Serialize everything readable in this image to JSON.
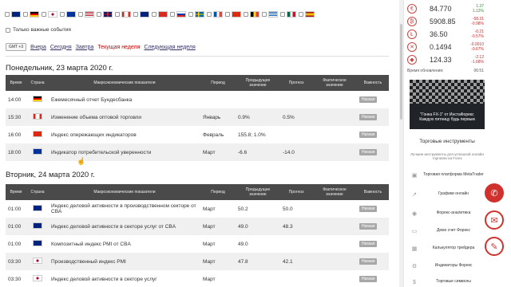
{
  "filters": {
    "important_only_label": "Только важные события"
  },
  "periods": {
    "tz": "GMT +3",
    "yesterday": "Вчера",
    "today": "Сегодня",
    "tomorrow": "Завтра",
    "this_week": "Текущая неделя",
    "next_week": "Следующая неделя"
  },
  "columns": {
    "time": "Время",
    "country": "Страна",
    "indicator": "Макроэкономические показатели",
    "period": "Период",
    "previous": "Предыдущее значение",
    "forecast": "Прогноз",
    "actual": "Фактическое значение",
    "importance": "Важность"
  },
  "day1": {
    "title": "Понедельник, 23 марта 2020 г.",
    "rows": [
      {
        "time": "14:00",
        "flag": "de",
        "name": "Ежемесячный отчет Бундесбанка",
        "period": "",
        "prev": "",
        "forecast": "",
        "actual": "",
        "imp": "Низкая"
      },
      {
        "time": "15:30",
        "flag": "ca",
        "name": "Изменение объема оптовой торговли",
        "period": "Январь",
        "prev": "0.9%",
        "forecast": "0.5%",
        "actual": "",
        "imp": "Низкая"
      },
      {
        "time": "16:00",
        "flag": "cn",
        "name": "Индекс опережающих индикаторов",
        "period": "Февраль",
        "prev": "155.8; 1.0%",
        "forecast": "",
        "actual": "",
        "imp": "Низкая"
      },
      {
        "time": "18:00",
        "flag": "eu",
        "name": "Индикатор потребительской уверенности",
        "period": "Март",
        "prev": "-6.6",
        "forecast": "-14.0",
        "actual": "",
        "imp": "Низкая"
      }
    ]
  },
  "day2": {
    "title": "Вторник, 24 марта 2020 г.",
    "rows": [
      {
        "time": "01:00",
        "flag": "au",
        "name": "Индекс деловой активности в производственном секторе от CBA",
        "period": "Март",
        "prev": "50.2",
        "forecast": "50.0",
        "actual": "",
        "imp": "Низкая"
      },
      {
        "time": "01:00",
        "flag": "au",
        "name": "Индекс деловой активности в секторе услуг от CBA",
        "period": "Март",
        "prev": "49.0",
        "forecast": "48.3",
        "actual": "",
        "imp": "Низкая"
      },
      {
        "time": "01:00",
        "flag": "au",
        "name": "Композитный индекс PMI от CBA",
        "period": "Март",
        "prev": "49.0",
        "forecast": "",
        "actual": "",
        "imp": "Низкая"
      },
      {
        "time": "03:30",
        "flag": "jp",
        "name": "Производственный индекс PMI",
        "period": "Март",
        "prev": "47.8",
        "forecast": "42.1",
        "actual": "",
        "imp": "Низкая"
      },
      {
        "time": "03:30",
        "flag": "jp",
        "name": "Индекс деловой активности в секторе услуг",
        "period": "Март",
        "prev": "",
        "forecast": "",
        "actual": "",
        "imp": "Низкая"
      }
    ]
  },
  "quotes": [
    {
      "icon": "€",
      "value": "84.770",
      "chg1": "1.37",
      "chg2": "1.12%",
      "dir": "up"
    },
    {
      "icon": "₿",
      "value": "5908.85",
      "chg1": "-58.31",
      "chg2": "-0.98%",
      "dir": "dn"
    },
    {
      "icon": "Ł",
      "value": "36.50",
      "chg1": "-0.21",
      "chg2": "-0.57%",
      "dir": "dn"
    },
    {
      "icon": "✕",
      "value": "0.1494",
      "chg1": "-0.0010",
      "chg2": "-0.67%",
      "dir": "dn"
    },
    {
      "icon": "◆",
      "value": "124.33",
      "chg1": "-2.12",
      "chg2": "-1.68%",
      "dir": "dn"
    }
  ],
  "update": {
    "label": "Время обновления:",
    "time": "06:51"
  },
  "banner_text": "\"Гонка FX-1\" от ИнстаФорекс Каждую пятницу будь первым",
  "tools": {
    "title": "Торговые инструменты",
    "subtitle": "Лучшие инструменты для успешной онлайн торговли на Forex",
    "items": [
      {
        "icon": "▣",
        "label": "Торговая платформа MetaTrader"
      },
      {
        "icon": "↗",
        "label": "Графики онлайн"
      },
      {
        "icon": "◉",
        "label": "Форекс-аналитика"
      },
      {
        "icon": "▭",
        "label": "Демо счет Форекс"
      },
      {
        "icon": "▦",
        "label": "Калькулятор трейдера"
      },
      {
        "icon": "⚙",
        "label": "Индикаторы Форекс"
      },
      {
        "icon": "$",
        "label": "Торговые символы"
      }
    ]
  },
  "colors": {
    "accent": "#d0312d",
    "header": "#4a4a4a",
    "link": "#cc3333"
  }
}
